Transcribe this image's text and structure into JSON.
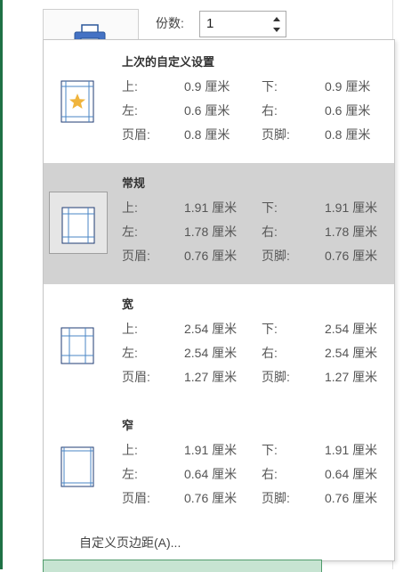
{
  "copies": {
    "label": "份数:",
    "value": "1"
  },
  "options": [
    {
      "title": "上次的自定义设置",
      "icon": "margin-custom-star-icon",
      "selected": false,
      "rows": [
        [
          "上:",
          "0.9 厘米",
          "下:",
          "0.9 厘米"
        ],
        [
          "左:",
          "0.6 厘米",
          "右:",
          "0.6 厘米"
        ],
        [
          "页眉:",
          "0.8 厘米",
          "页脚:",
          "0.8 厘米"
        ]
      ]
    },
    {
      "title": "常规",
      "icon": "margin-normal-icon",
      "selected": true,
      "rows": [
        [
          "上:",
          "1.91 厘米",
          "下:",
          "1.91 厘米"
        ],
        [
          "左:",
          "1.78 厘米",
          "右:",
          "1.78 厘米"
        ],
        [
          "页眉:",
          "0.76 厘米",
          "页脚:",
          "0.76 厘米"
        ]
      ]
    },
    {
      "title": "宽",
      "icon": "margin-wide-icon",
      "selected": false,
      "rows": [
        [
          "上:",
          "2.54 厘米",
          "下:",
          "2.54 厘米"
        ],
        [
          "左:",
          "2.54 厘米",
          "右:",
          "2.54 厘米"
        ],
        [
          "页眉:",
          "1.27 厘米",
          "页脚:",
          "1.27 厘米"
        ]
      ]
    },
    {
      "title": "窄",
      "icon": "margin-narrow-icon",
      "selected": false,
      "rows": [
        [
          "上:",
          "1.91 厘米",
          "下:",
          "1.91 厘米"
        ],
        [
          "左:",
          "0.64 厘米",
          "右:",
          "0.64 厘米"
        ],
        [
          "页眉:",
          "0.76 厘米",
          "页脚:",
          "0.76 厘米"
        ]
      ]
    }
  ],
  "custom_margins_link": "自定义页边距(A)...",
  "colors": {
    "accent": "#1e7145",
    "selected_bg": "#d2d2d2",
    "star": "#f0b43c"
  }
}
